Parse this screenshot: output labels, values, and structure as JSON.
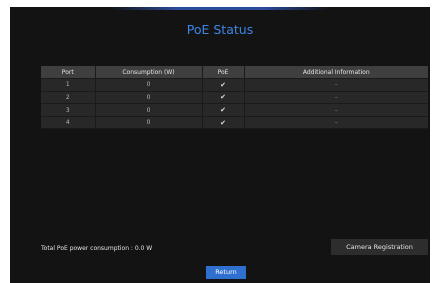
{
  "dialog": {
    "title": "PoE Status"
  },
  "table": {
    "headers": [
      "Port",
      "Consumption (W)",
      "PoE",
      "Additional Information"
    ],
    "rows": [
      {
        "port": "1",
        "consumption": "0",
        "poe": "✔",
        "info": "–"
      },
      {
        "port": "2",
        "consumption": "0",
        "poe": "✔",
        "info": "–"
      },
      {
        "port": "3",
        "consumption": "0",
        "poe": "✔",
        "info": "–"
      },
      {
        "port": "4",
        "consumption": "0",
        "poe": "✔",
        "info": "–"
      }
    ]
  },
  "footer": {
    "total_label": "Total PoE power consumption : 0.0 W",
    "camera_registration_label": "Camera Registration",
    "return_label": "Return"
  },
  "colors": {
    "title": "#3d86e6",
    "return_button": "#2f6fd0",
    "background": "#131313",
    "table_header": "#3f3f3f",
    "table_cell": "#282828"
  },
  "icons": {
    "poe_enabled": "check-icon",
    "no_info": "dash-icon"
  }
}
